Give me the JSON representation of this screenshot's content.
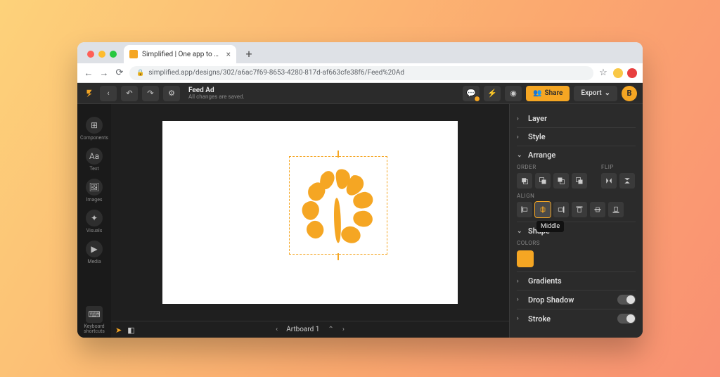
{
  "browser": {
    "tab_title": "Simplified | One app to design...",
    "url": "simplified.app/designs/302/a6ac7f69-8653-4280-817d-af663cfe38f6/Feed%20Ad"
  },
  "app": {
    "doc_title": "Feed Ad",
    "doc_status": "All changes are saved.",
    "share_label": "Share",
    "export_label": "Export",
    "avatar_initial": "B"
  },
  "rail": {
    "items": [
      {
        "icon": "",
        "label": ""
      },
      {
        "icon": "⊞",
        "label": "Components"
      },
      {
        "icon": "Aa",
        "label": "Text"
      },
      {
        "icon": "🖼",
        "label": "Images"
      },
      {
        "icon": "✦",
        "label": "Visuals"
      },
      {
        "icon": "▶",
        "label": "Media"
      }
    ],
    "footer": {
      "icon": "⌨",
      "label": "Keyboard shortcuts"
    }
  },
  "artboard_bar": {
    "label": "Artboard 1"
  },
  "inspector": {
    "sections": {
      "layer": "Layer",
      "style": "Style",
      "arrange": "Arrange",
      "shape": "Shape",
      "gradients": "Gradients",
      "drop_shadow": "Drop Shadow",
      "stroke": "Stroke"
    },
    "labels": {
      "order": "ORDER",
      "flip": "FLIP",
      "align": "ALIGN",
      "colors": "COLORS"
    },
    "tooltip": "Middle",
    "shape_color": "#f5a623"
  }
}
